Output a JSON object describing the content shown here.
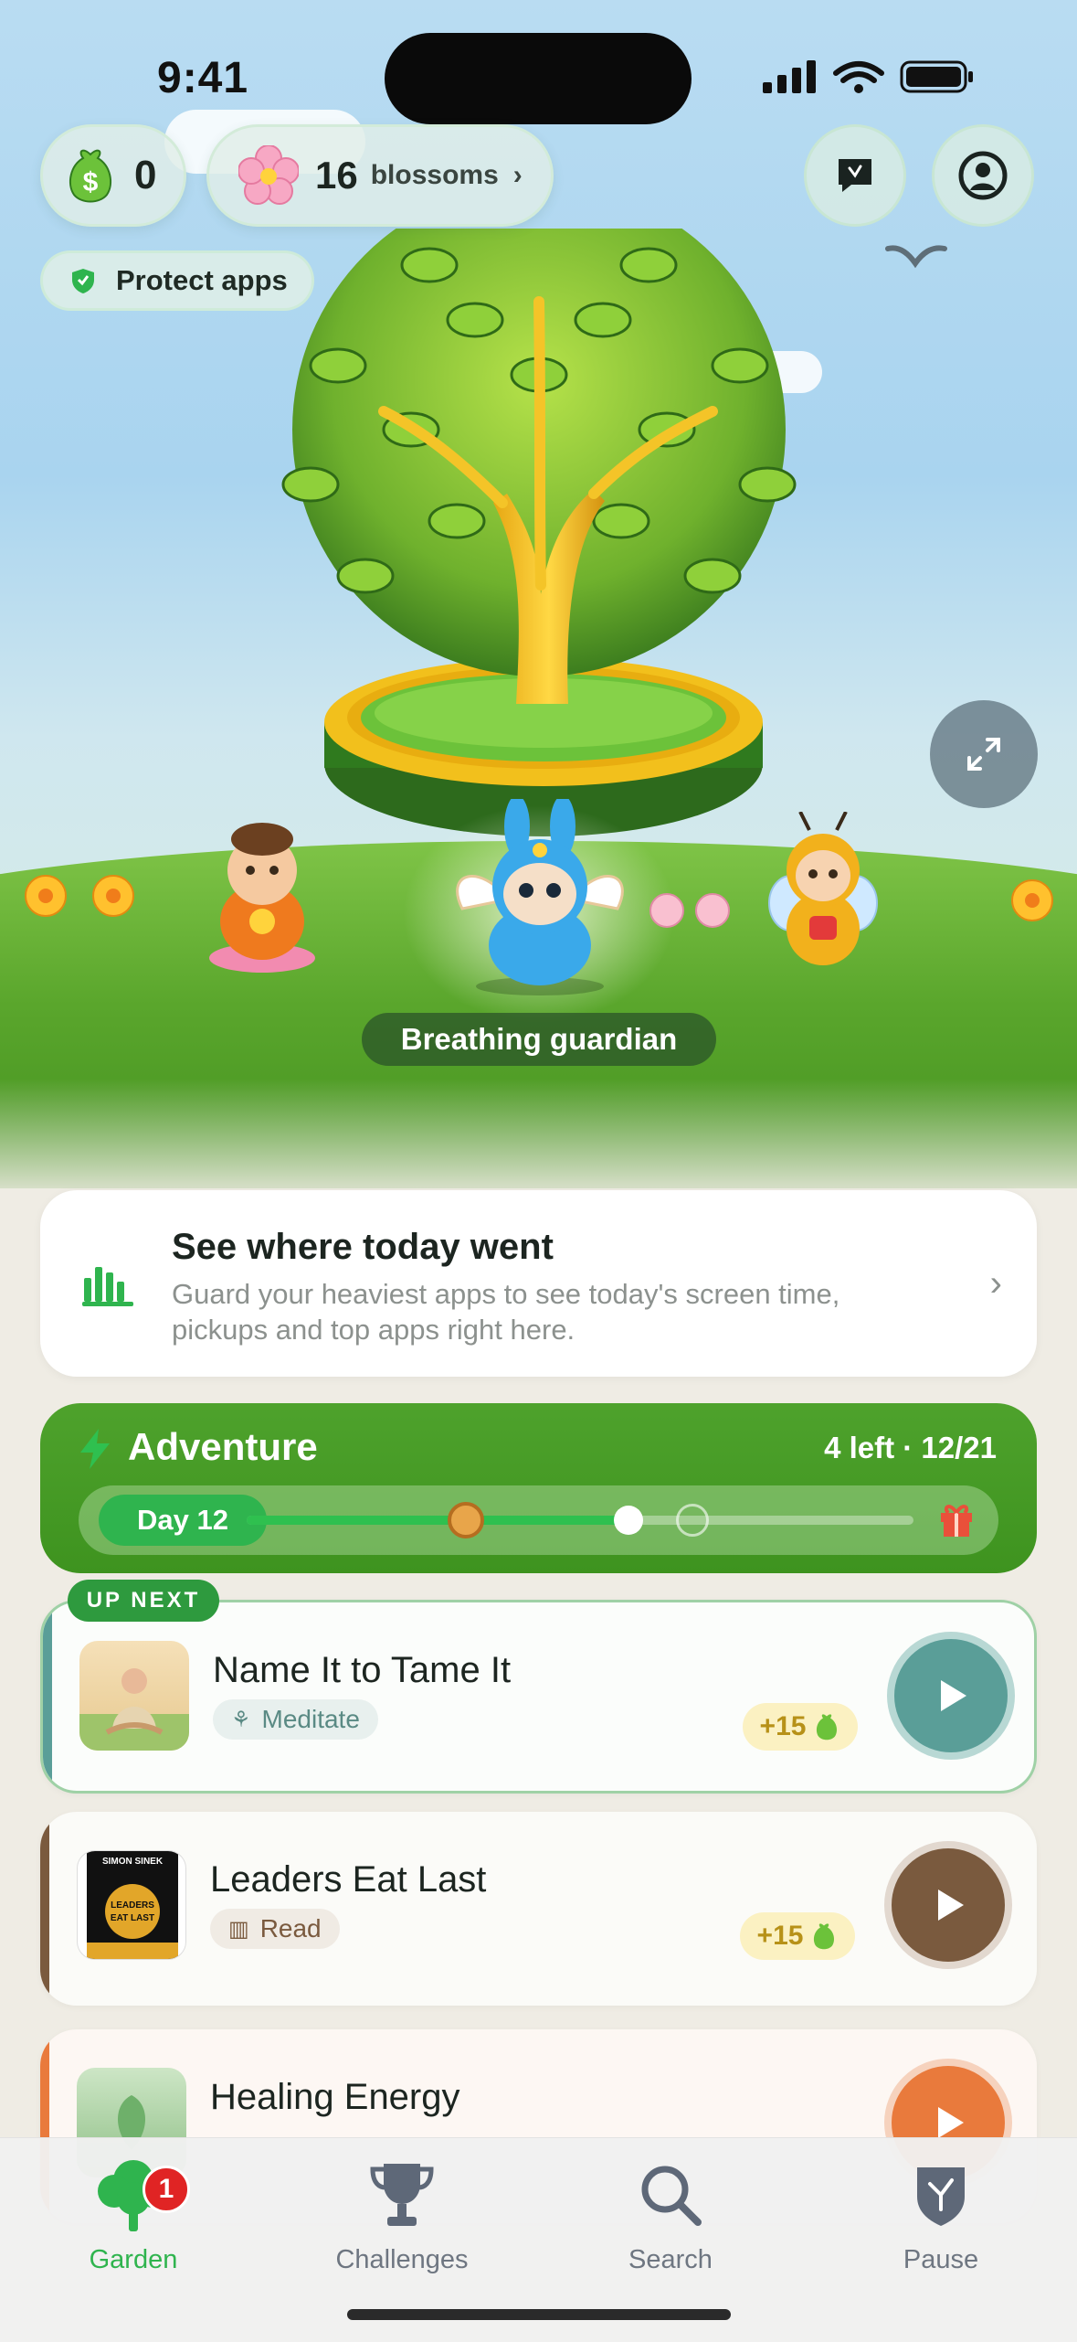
{
  "status_bar": {
    "time": "9:41"
  },
  "header": {
    "coins": "0",
    "blossoms_count": "16",
    "blossoms_label": "blossoms",
    "protect_label": "Protect apps"
  },
  "scene": {
    "guardian_label": "Breathing guardian"
  },
  "today_card": {
    "title": "See where today went",
    "subtitle": "Guard your heaviest apps to see today's screen time, pickups and top apps right here."
  },
  "adventure": {
    "title": "Adventure",
    "meta": "4 left · 12/21",
    "day_label": "Day 12",
    "progress": 0.57
  },
  "up_next_label": "UP NEXT",
  "lessons": [
    {
      "name": "Name It to Tame It",
      "tag": "Meditate",
      "reward": "+15",
      "accent": "#5a9e98"
    },
    {
      "name": "Leaders Eat Last",
      "tag": "Read",
      "reward": "+15",
      "accent": "#7a5a3e",
      "book_author": "SIMON SINEK",
      "book_title_1": "LEADERS",
      "book_title_2": "EAT LAST"
    },
    {
      "name": "Healing Energy",
      "accent": "#e97a3c"
    }
  ],
  "tabs": [
    {
      "label": "Garden",
      "badge": "1"
    },
    {
      "label": "Challenges"
    },
    {
      "label": "Search"
    },
    {
      "label": "Pause"
    }
  ],
  "colors": {
    "primary_green": "#2fb44e",
    "adventure_green": "#4ea22c",
    "reward_gold": "#b79118"
  }
}
